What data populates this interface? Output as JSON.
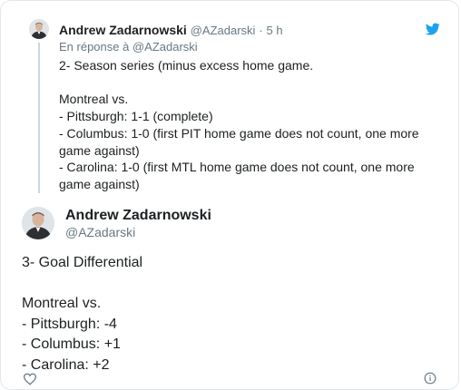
{
  "parent_tweet": {
    "author_name": "Andrew Zadarnowski",
    "handle": "@AZadarski",
    "separator": "·",
    "time": "5 h",
    "reply_to": "En réponse à @AZadarski",
    "lines": [
      "2- Season series (minus excess home game.",
      "",
      "Montreal vs.",
      "- Pittsburgh: 1-1 (complete)",
      "- Columbus: 1-0 (first PIT home game does not count, one more game against)",
      "- Carolina: 1-0 (first MTL home game does not count, one more game against)"
    ]
  },
  "main_tweet": {
    "author_name": "Andrew Zadarnowski",
    "handle": "@AZadarski",
    "lines": [
      "3- Goal Differential",
      "",
      "Montreal vs.",
      "- Pittsburgh: -4",
      "- Columbus: +1",
      "- Carolina: +2"
    ]
  },
  "icons": {
    "brand": "twitter-bird-icon",
    "like": "heart-icon",
    "info": "info-icon"
  },
  "colors": {
    "twitter_blue": "#1da1f2",
    "text_primary": "#1c2022",
    "text_secondary": "#697882",
    "border": "#e1e8ed",
    "thread_line": "#ccd6dd"
  }
}
